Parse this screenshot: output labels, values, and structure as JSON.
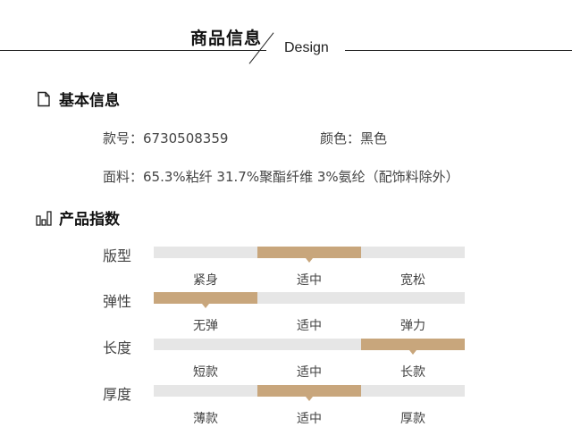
{
  "header": {
    "title_cn": "商品信息",
    "title_en": "Design"
  },
  "basic": {
    "heading": "基本信息",
    "icon": "document-icon",
    "style_no": "款号：6730508359",
    "color": "颜色：黑色",
    "fabric": "面料：65.3%粘纤 31.7%聚酯纤维 3%氨纶（配饰料除外）"
  },
  "index": {
    "heading": "产品指数",
    "icon": "bar-chart-icon",
    "accent": "#c8a67c",
    "rows": [
      {
        "label": "版型",
        "options": [
          "紧身",
          "适中",
          "宽松"
        ],
        "selected": 1
      },
      {
        "label": "弹性",
        "options": [
          "无弹",
          "适中",
          "弹力"
        ],
        "selected": 0
      },
      {
        "label": "长度",
        "options": [
          "短款",
          "适中",
          "长款"
        ],
        "selected": 2
      },
      {
        "label": "厚度",
        "options": [
          "薄款",
          "适中",
          "厚款"
        ],
        "selected": 1
      }
    ]
  }
}
